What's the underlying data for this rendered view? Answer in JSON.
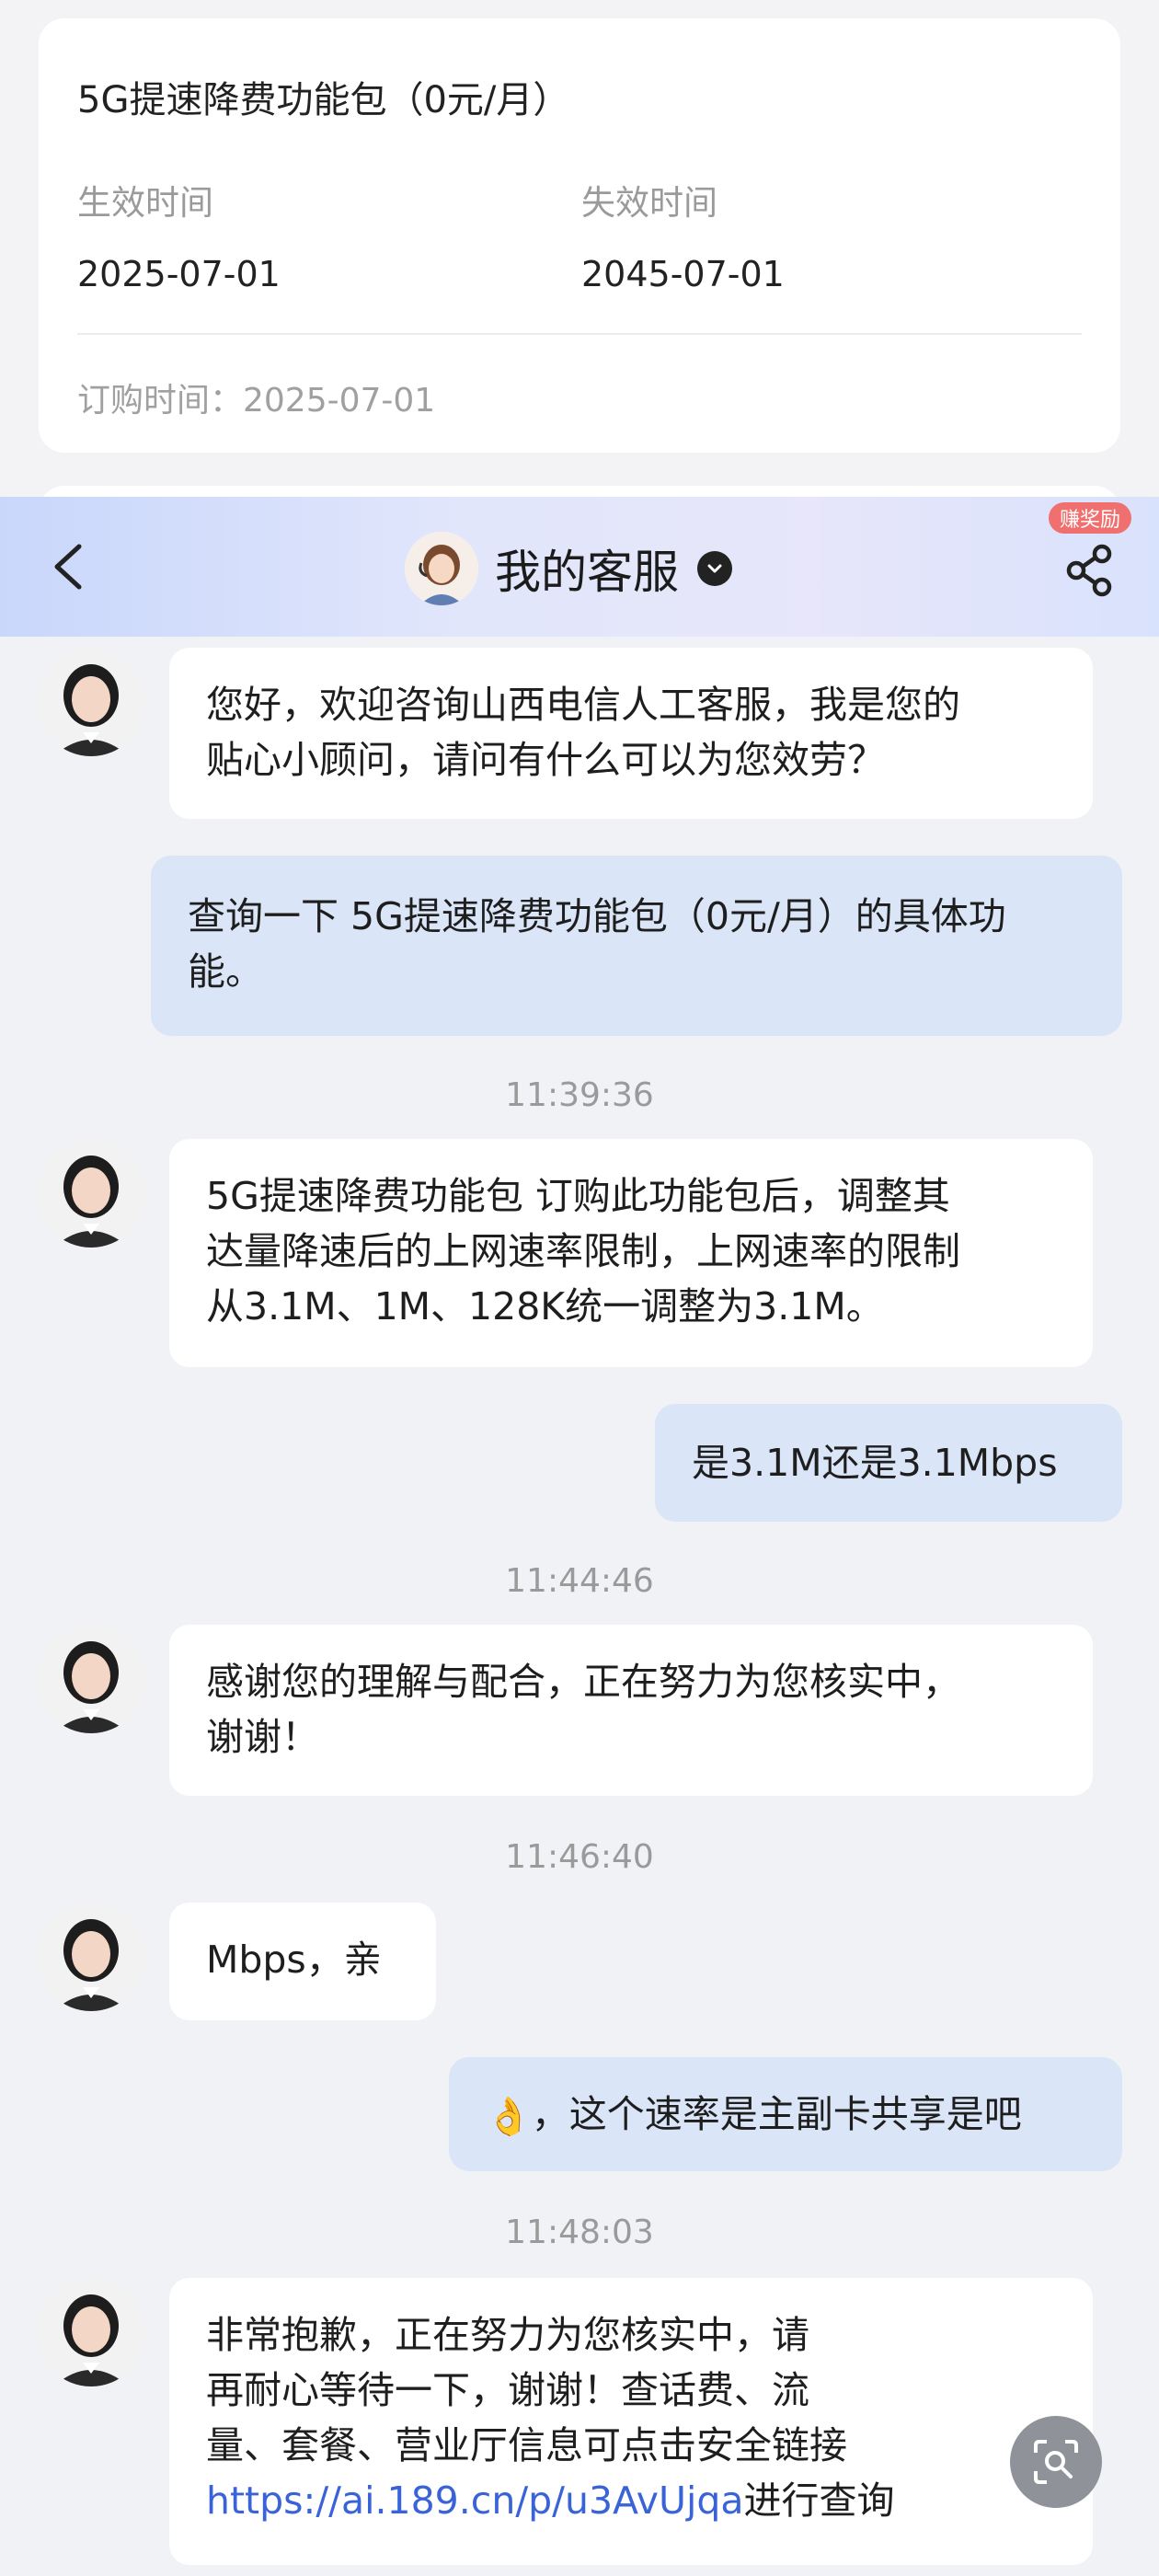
{
  "package": {
    "title": "5G提速降费功能包（0元/月）",
    "effective_label": "生效时间",
    "effective_date": "2025-07-01",
    "expire_label": "失效时间",
    "expire_date": "2045-07-01",
    "order_time": "订购时间：2025-07-01"
  },
  "header": {
    "title": "我的客服",
    "reward_badge": "赚奖励"
  },
  "messages": {
    "m1": {
      "line1": "您好，欢迎咨询山西电信人工客服，我是您的",
      "line2": "贴心小顾问，请问有什么可以为您效劳？"
    },
    "m2": {
      "line1": "查询一下 5G提速降费功能包（0元/月）的具体功",
      "line2": "能。"
    },
    "t1": "11:39:36",
    "m3": {
      "line1": "5G提速降费功能包 订购此功能包后，调整其",
      "line2": "达量降速后的上网速率限制，上网速率的限制",
      "line3": "从3.1M、1M、128K统一调整为3.1M。"
    },
    "m4": {
      "line1": "是3.1M还是3.1Mbps"
    },
    "t2": "11:44:46",
    "m5": {
      "line1": "感谢您的理解与配合，正在努力为您核实中，",
      "line2": "谢谢！"
    },
    "t3": "11:46:40",
    "m6": {
      "line1": "Mbps，亲"
    },
    "m7": {
      "emoji": "👌",
      "line1": "，这个速率是主副卡共享是吧"
    },
    "t4": "11:48:03",
    "m8": {
      "line1": "非常抱歉，正在努力为您核实中，请",
      "line2": "再耐心等待一下，谢谢！查话费、流",
      "line3": "量、套餐、营业厅信息可点击安全链接",
      "link": "https://ai.189.cn/p/u3AvUjqa",
      "link_suffix": "进行查询"
    }
  },
  "colors": {
    "accent_link": "#3a63d8",
    "outgoing_bubble": "#dbe5f8",
    "reward_badge": "#f07070"
  }
}
